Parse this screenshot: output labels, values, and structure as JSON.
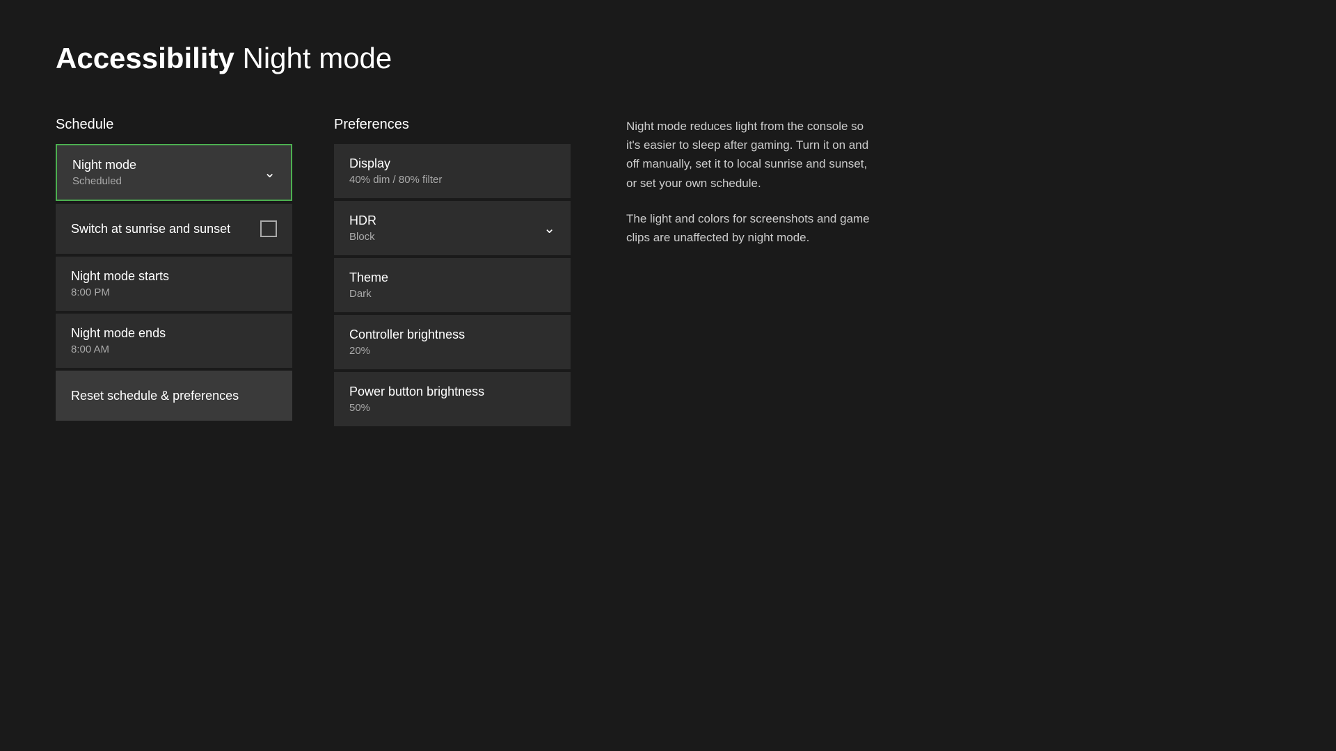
{
  "page": {
    "title_bold": "Accessibility",
    "title_regular": "Night mode"
  },
  "schedule": {
    "header": "Schedule",
    "items": [
      {
        "id": "night-mode",
        "label": "Night mode",
        "value": "Scheduled",
        "has_chevron": true,
        "selected": true
      },
      {
        "id": "switch-sunrise-sunset",
        "label": "Switch at sunrise and sunset",
        "value": null,
        "has_checkbox": true,
        "selected": false
      },
      {
        "id": "night-mode-starts",
        "label": "Night mode starts",
        "value": "8:00 PM",
        "has_chevron": false,
        "selected": false
      },
      {
        "id": "night-mode-ends",
        "label": "Night mode ends",
        "value": "8:00 AM",
        "has_chevron": false,
        "selected": false
      }
    ],
    "reset_label": "Reset schedule & preferences"
  },
  "preferences": {
    "header": "Preferences",
    "items": [
      {
        "id": "display",
        "label": "Display",
        "value": "40% dim / 80% filter",
        "has_chevron": false
      },
      {
        "id": "hdr",
        "label": "HDR",
        "value": "Block",
        "has_chevron": true
      },
      {
        "id": "theme",
        "label": "Theme",
        "value": "Dark",
        "has_chevron": false
      },
      {
        "id": "controller-brightness",
        "label": "Controller brightness",
        "value": "20%",
        "has_chevron": false
      },
      {
        "id": "power-button-brightness",
        "label": "Power button brightness",
        "value": "50%",
        "has_chevron": false
      }
    ]
  },
  "info": {
    "paragraph1": "Night mode reduces light from the console so it's easier to sleep after gaming. Turn it on and off manually, set it to local sunrise and sunset, or set your own schedule.",
    "paragraph2": "The light and colors for screenshots and game clips are unaffected by night mode."
  },
  "icons": {
    "chevron": "⌵",
    "checkbox_empty": ""
  }
}
